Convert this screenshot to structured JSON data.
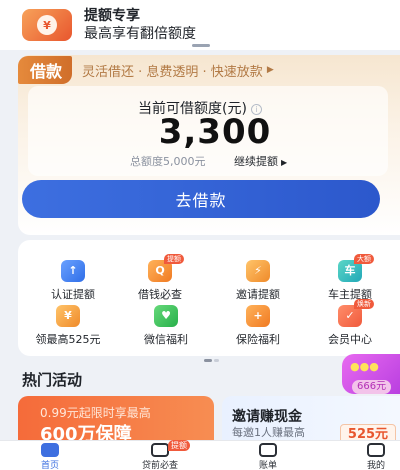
{
  "banner": {
    "icon": "yuan-coin-icon",
    "title": "提额专享",
    "subtitle": "最高享有翻倍额度"
  },
  "loan": {
    "badge": "借款",
    "slogan": "灵活借还 · 息费透明 · 快速放款",
    "limit_label": "当前可借额度(元)",
    "limit_amount": "3,300",
    "total_limit": "总额度5,000元",
    "raise_link": "继续提额",
    "borrow_button": "去借款"
  },
  "services": [
    {
      "label": "认证提额",
      "icon": "upload-arrow-icon",
      "tag": ""
    },
    {
      "label": "借钱必查",
      "icon": "magnifier-icon",
      "tag": "提额"
    },
    {
      "label": "邀请提额",
      "icon": "lightning-icon",
      "tag": ""
    },
    {
      "label": "车主提额",
      "icon": "car-icon",
      "tag": "大额"
    },
    {
      "label": "领最高525元",
      "icon": "red-packet-icon",
      "tag": ""
    },
    {
      "label": "微信福利",
      "icon": "heart-shield-icon",
      "tag": ""
    },
    {
      "label": "保险福利",
      "icon": "plus-shield-icon",
      "tag": ""
    },
    {
      "label": "会员中心",
      "icon": "member-crown-icon",
      "tag": "焕新"
    }
  ],
  "hot": {
    "title": "热门活动",
    "float_amount": "666元",
    "promo_left": {
      "line1": "0.99元起限时享最高",
      "line2": "600万保障"
    },
    "promo_right": {
      "title": "邀请赚现金",
      "subtitle": "每邀1人赚最高",
      "amount": "525元"
    }
  },
  "tabs": [
    {
      "label": "首页",
      "icon": "home-icon",
      "active": true,
      "badge": ""
    },
    {
      "label": "贷前必查",
      "icon": "shield-check-icon",
      "active": false,
      "badge": "提额"
    },
    {
      "label": "账单",
      "icon": "bill-icon",
      "active": false,
      "badge": ""
    },
    {
      "label": "我的",
      "icon": "profile-icon",
      "active": false,
      "badge": ""
    }
  ],
  "colors": {
    "primary_blue": "#3d6fe0",
    "accent_orange": "#e8562e",
    "loan_gold": "#d06e2a"
  }
}
